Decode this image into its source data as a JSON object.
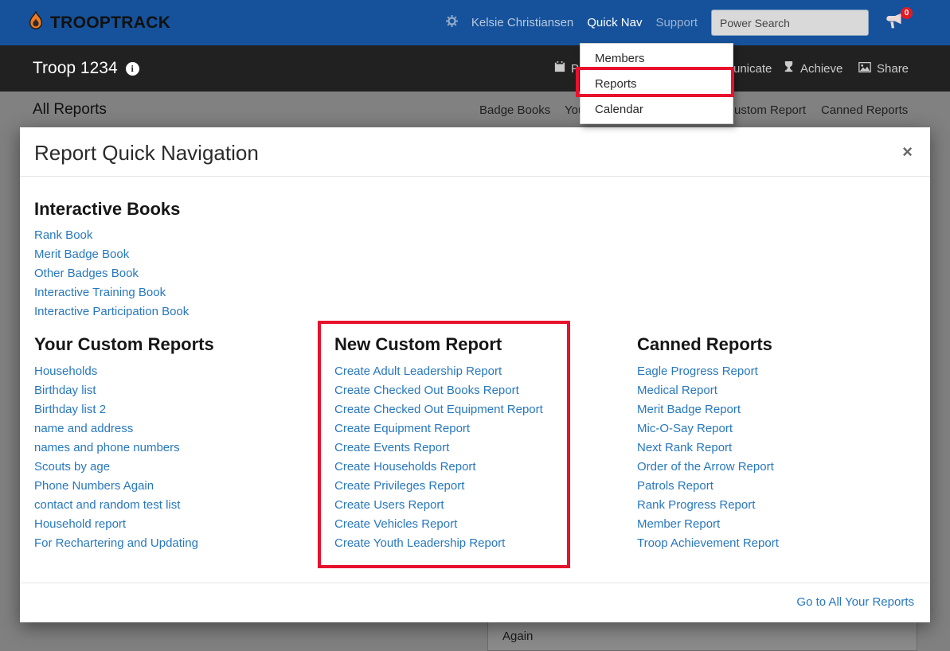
{
  "colors": {
    "navbar_blue": "#15529b",
    "subnav_black": "#212121",
    "link_blue": "#2778be",
    "annotation_red": "#e8112d",
    "badge_red": "#e01b24"
  },
  "navbar": {
    "brand": "TROOPTRACK",
    "user_name": "Kelsie Christiansen",
    "quick_nav_label": "Quick Nav",
    "support_label": "Support",
    "search_placeholder": "Power Search",
    "notification_count": "0"
  },
  "quicknav_menu": {
    "items": [
      "Members",
      "Reports",
      "Calendar"
    ]
  },
  "subnav": {
    "troop_name": "Troop 1234",
    "fragments": [
      "Pl",
      "unicate",
      "Achieve",
      "Share"
    ]
  },
  "reports_bar": {
    "title": "All Reports",
    "fragments": [
      "Badge Books",
      "You",
      "ustom Report",
      "Canned Reports"
    ]
  },
  "modal": {
    "title": "Report Quick Navigation",
    "close_label": "×",
    "interactive_books": {
      "heading": "Interactive Books",
      "links": [
        "Rank Book",
        "Merit Badge Book",
        "Other Badges Book",
        "Interactive Training Book",
        "Interactive Participation Book"
      ]
    },
    "columns": [
      {
        "heading": "Your Custom Reports",
        "links": [
          "Households",
          "Birthday list",
          "Birthday list 2",
          "name and address",
          "names and phone numbers",
          "Scouts by age",
          "Phone Numbers Again",
          "contact and random test list",
          "Household report",
          "For Rechartering and Updating"
        ]
      },
      {
        "heading": "New Custom Report",
        "links": [
          "Create Adult Leadership Report",
          "Create Checked Out Books Report",
          "Create Checked Out Equipment Report",
          "Create Equipment Report",
          "Create Events Report",
          "Create Households Report",
          "Create Privileges Report",
          "Create Users Report",
          "Create Vehicles Report",
          "Create Youth Leadership Report"
        ]
      },
      {
        "heading": "Canned Reports",
        "links": [
          "Eagle Progress Report",
          "Medical Report",
          "Merit Badge Report",
          "Mic-O-Say Report",
          "Next Rank Report",
          "Order of the Arrow Report",
          "Patrols Report",
          "Rank Progress Report",
          "Member Report",
          "Troop Achievement Report"
        ]
      }
    ],
    "footer_link": "Go to All Your Reports"
  },
  "background": {
    "partial_row_text": "Again"
  }
}
